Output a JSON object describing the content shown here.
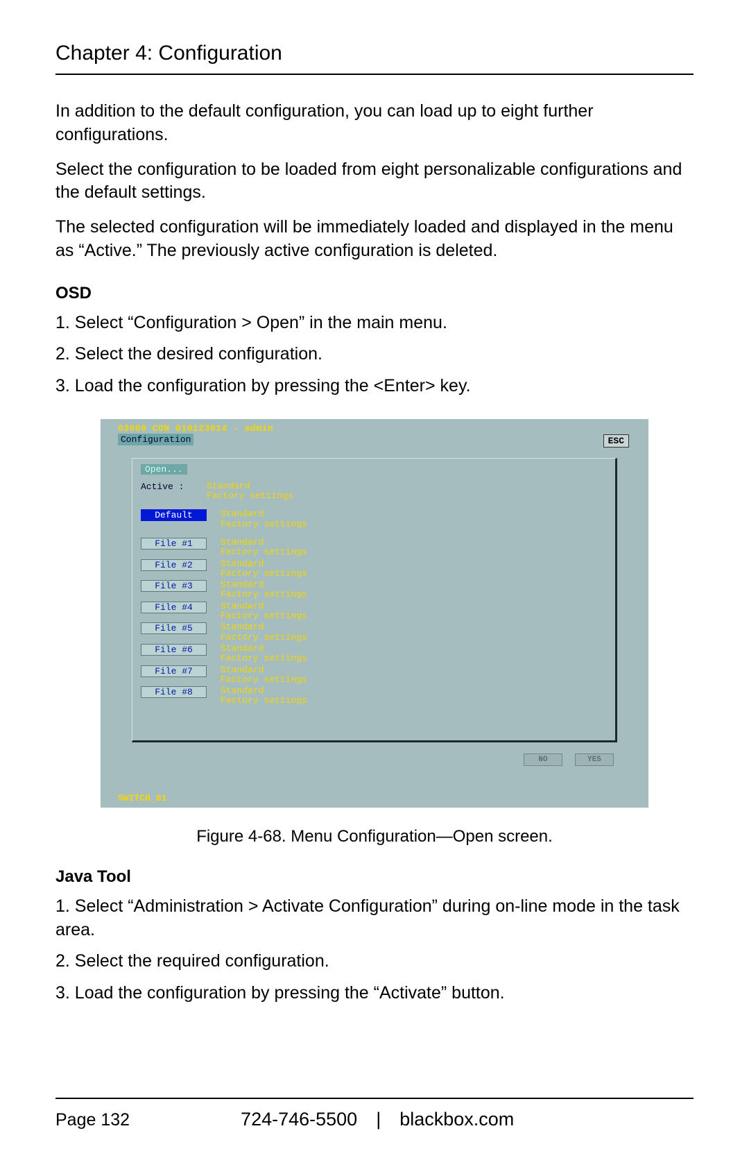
{
  "chapter_title": "Chapter 4: Configuration",
  "paragraphs": {
    "p1": "In addition to the default configuration, you can load up to eight further configurations.",
    "p2": "Select the configuration to be loaded from eight personalizable configurations and the default settings.",
    "p3": "The selected configuration will be immediately loaded and displayed in the menu as “Active.” The previously active configuration is deleted."
  },
  "osd_section": {
    "label": "OSD",
    "steps": [
      "1. Select “Configuration > Open” in the main menu.",
      "2. Select the desired configuration.",
      "3. Load the configuration by pressing the <Enter> key."
    ]
  },
  "osd_screen": {
    "titlebar": "03000 CON 010123614 - admin",
    "menu": "Configuration",
    "esc": "ESC",
    "open_label": "Open...",
    "active_label": "Active  :",
    "default_label": "Default",
    "value_line1": "Standard",
    "value_line2": "Factory settings",
    "files": [
      "File #1",
      "File #2",
      "File #3",
      "File #4",
      "File #5",
      "File #6",
      "File #7",
      "File #8"
    ],
    "btn_no": "NO",
    "btn_yes": "YES",
    "footer": "SWITCH_01"
  },
  "figure_caption": "Figure 4-68. Menu Configuration—Open screen.",
  "java_section": {
    "label": "Java Tool",
    "steps": [
      "1. Select “Administration > Activate Configuration” during on-line mode in the task area.",
      "2. Select the required configuration.",
      "3. Load the configuration by pressing the “Activate” button."
    ]
  },
  "footer": {
    "page": "Page 132",
    "contact": "724-746-5500 | blackbox.com"
  }
}
